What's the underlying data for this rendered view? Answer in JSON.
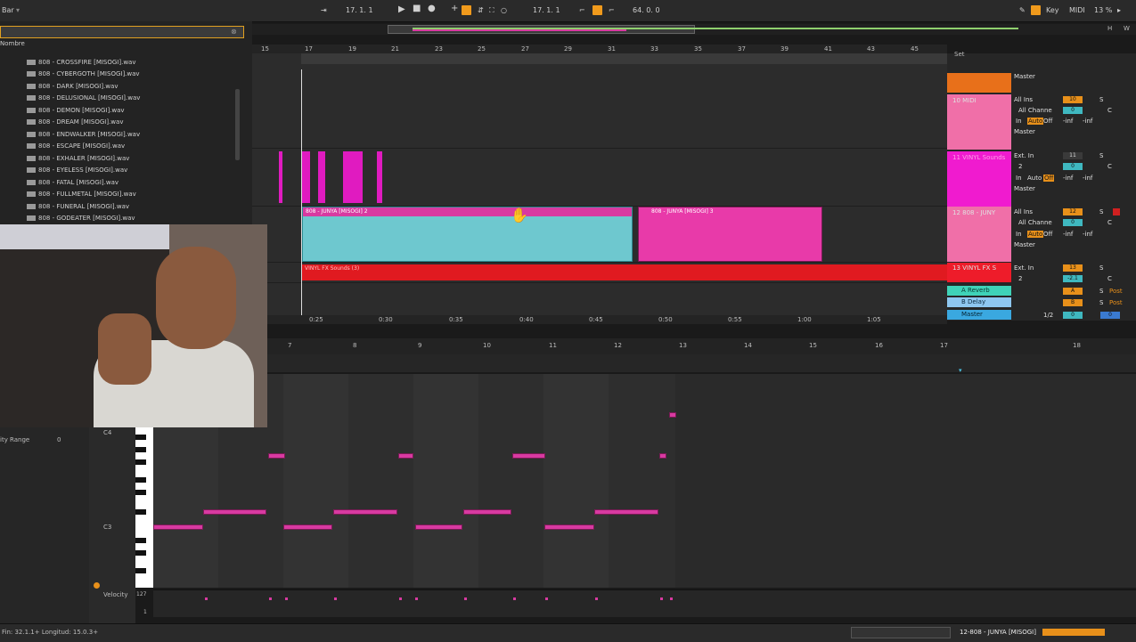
{
  "topbar": {
    "menu_label": "Bar",
    "position": "17.  1.  1",
    "loop_start": "17.  1.  1",
    "loop_length": "64.  0.  0",
    "key_label": "Key",
    "midi_label": "MIDI",
    "cpu": "13 %",
    "h_label": "H",
    "w_label": "W"
  },
  "browser": {
    "header_label": "Nombre",
    "items": [
      "808 - CROSSFIRE [MISOGI].wav",
      "808 - CYBERGOTH [MISOGI].wav",
      "808 - DARK [MISOGI].wav",
      "808 - DELUSIONAL [MISOGI].wav",
      "808 - DEMON [MISOGI].wav",
      "808 - DREAM [MISOGI].wav",
      "808 - ENDWALKER [MISOGI].wav",
      "808 - ESCAPE [MISOGI].wav",
      "808 - EXHALER [MISOGI].wav",
      "808 - EYELESS [MISOGI].wav",
      "808 - FATAL [MISOGI].wav",
      "808 - FULLMETAL [MISOGI].wav",
      "808 - FUNERAL [MISOGI].wav",
      "808 - GODEATER [MISOGI].wav"
    ]
  },
  "arrangement": {
    "bar_numbers": [
      "15",
      "17",
      "19",
      "21",
      "23",
      "25",
      "27",
      "29",
      "31",
      "33",
      "35",
      "37",
      "39",
      "41",
      "43",
      "45"
    ],
    "time_labels": [
      "0:25",
      "0:30",
      "0:35",
      "0:40",
      "0:45",
      "0:50",
      "0:55",
      "1:00",
      "1:05"
    ],
    "clip_808_a": "808 - JUNYA [MISOGI] 2",
    "clip_808_b": "808 - JUNYA [MISOGI] 3",
    "clip_vinyl": "VINYL FX Sounds (3)"
  },
  "mixer": {
    "set_label": "Set",
    "tracks": [
      {
        "name": "10 MIDI",
        "input": "All Ins",
        "channel": "All Channe",
        "out": "Master",
        "num": "10",
        "color": "#f06fa8"
      },
      {
        "name": "11 VINYL Sounds",
        "input": "Ext. In",
        "channel": "2",
        "out": "Master",
        "num": "11",
        "color": "#f01bcf"
      },
      {
        "name": "12 808 - JUNY",
        "input": "All Ins",
        "channel": "All Channe",
        "out": "Master",
        "num": "12",
        "color": "#f06fa8"
      },
      {
        "name": "13 VINYL FX S",
        "input": "Ext. In",
        "channel": "2",
        "out": "",
        "num": "13",
        "color": "#ee1c2a"
      }
    ],
    "returns": [
      "A Reverb",
      "B Delay"
    ],
    "master_label": "Master",
    "master_ratio": "1/2",
    "top_out": "Master",
    "vol_minus": "-2.1",
    "inf": "-inf",
    "zero": "0",
    "s_label": "S",
    "c_label": "C",
    "in_label": "In",
    "auto_label": "Auto",
    "off_label": "Off",
    "post_label": "Post",
    "a_label": "A",
    "b_label": "B"
  },
  "piano": {
    "timeline": [
      "7",
      "8",
      "9",
      "10",
      "11",
      "12",
      "13",
      "14",
      "15",
      "16",
      "17",
      "18"
    ],
    "c4": "C4",
    "c3": "C3",
    "velocity_label": "Velocity",
    "velocity_max": "127",
    "velocity_min": "1",
    "vel_range_label": "ity Range",
    "vel_range_value": "0"
  },
  "status": {
    "left_text": "Fin: 32.1.1+ Longitud: 15.0.3+",
    "right_text": "12-808 - JUNYA [MISOGI]"
  }
}
